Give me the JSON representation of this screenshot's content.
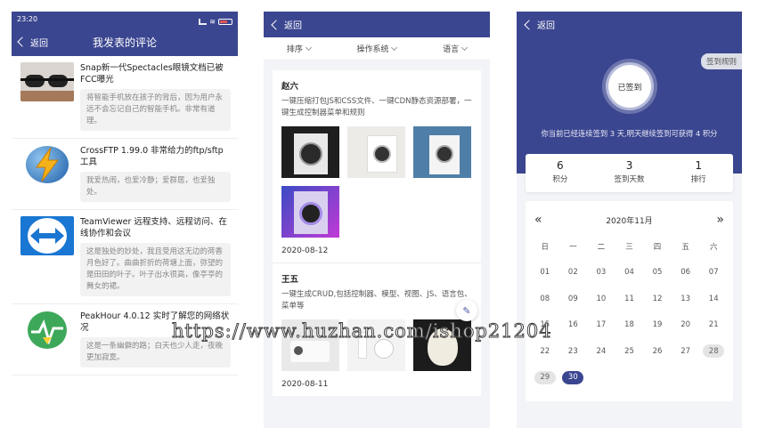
{
  "panel1": {
    "status_time": "23:20",
    "back_label": "返回",
    "title": "我发表的评论",
    "comments": [
      {
        "title": "Snap新一代Spectacles眼镜文档已被FCC曝光",
        "text": "将智能手机放在孩子的背后，因为用户永远不会忘记自己的智能手机。非常有道理。"
      },
      {
        "title": "CrossFTP 1.99.0 非常给力的ftp/sftp工具",
        "text": "我爱热闹，也爱冷静；爱群居，也爱独处。"
      },
      {
        "title": "TeamViewer 远程支持、远程访问、在线协作和会议",
        "text": "这是独处的妙处，我且受用这无边的荷香月色好了。曲曲折折的荷塘上面，弥望的是田田的叶子。叶子出水很高，像亭亭的舞女的裙。"
      },
      {
        "title": "PeakHour 4.0.12 实时了解您的网络状况",
        "text": "这是一条幽僻的路；白天也少人走，夜晚更加寂寞。"
      }
    ]
  },
  "panel2": {
    "back_label": "返回",
    "filters": [
      "排序",
      "操作系统",
      "语言"
    ],
    "posts": [
      {
        "author": "赵六",
        "desc": "一键压缩打包JS和CSS文件、一键CDN静态资源部署，一键生成控制器菜单和规则",
        "date": "2020-08-12"
      },
      {
        "author": "王五",
        "desc": "一键生成CRUD,包括控制器、模型、视图、JS、语言包、菜单等",
        "date": "2020-08-11"
      }
    ]
  },
  "panel3": {
    "back_label": "返回",
    "rules_label": "签到规则",
    "checkin_label": "已签到",
    "streak_text": "你当前已经连续签到 3 天,明天继续签到可获得 4 积分",
    "stats": [
      {
        "value": "6",
        "label": "积分"
      },
      {
        "value": "3",
        "label": "签到天数"
      },
      {
        "value": "1",
        "label": "排行"
      }
    ],
    "calendar": {
      "prev": "«",
      "next": "»",
      "month": "2020年11月",
      "weekdays": [
        "日",
        "一",
        "二",
        "三",
        "四",
        "五",
        "六"
      ],
      "days": [
        "01",
        "02",
        "03",
        "04",
        "05",
        "06",
        "07",
        "08",
        "09",
        "10",
        "11",
        "12",
        "13",
        "14",
        "15",
        "16",
        "17",
        "18",
        "19",
        "20",
        "21",
        "22",
        "23",
        "24",
        "25",
        "26",
        "27",
        "28",
        "29",
        "30"
      ],
      "checked_days": [
        "28",
        "29"
      ],
      "today": "30"
    }
  },
  "watermark": "https://www.huzhan.com/ishop21204"
}
